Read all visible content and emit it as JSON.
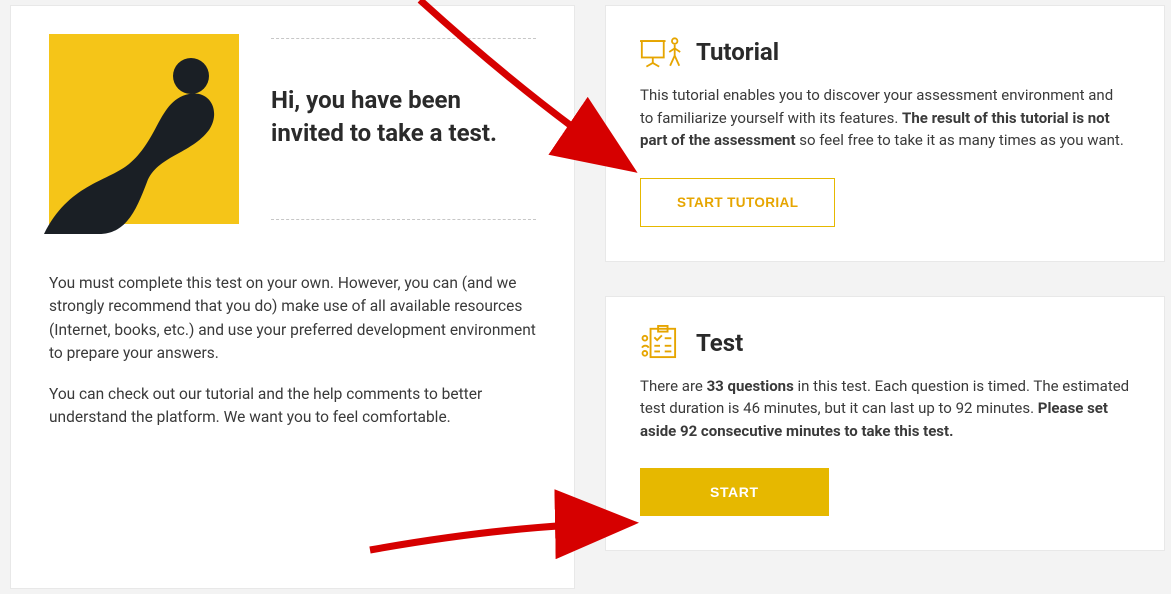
{
  "left": {
    "greeting": "Hi, you have been invited to take a test.",
    "para1": "You must complete this test on your own. However, you can (and we strongly recommend that you do) make use of all available resources (Internet, books, etc.) and use your preferred development environment to prepare your answers.",
    "para2": "You can check out our tutorial and the help comments to better understand the platform. We want you to feel comfortable."
  },
  "tutorial": {
    "title": "Tutorial",
    "text_pre": "This tutorial enables you to discover your assessment environment and to familiarize yourself with its features. ",
    "text_bold": "The result of this tutorial is not part of the assessment",
    "text_post": " so feel free to take it as many times as you want.",
    "button": "START TUTORIAL"
  },
  "test": {
    "title": "Test",
    "t1": "There are ",
    "t2_bold": "33 questions",
    "t3": " in this test. Each question is timed. The estimated test duration is 46 minutes, but it can last up to 92 minutes. ",
    "t4_bold": "Please set aside 92 consecutive minutes to take this test.",
    "button": "START"
  }
}
